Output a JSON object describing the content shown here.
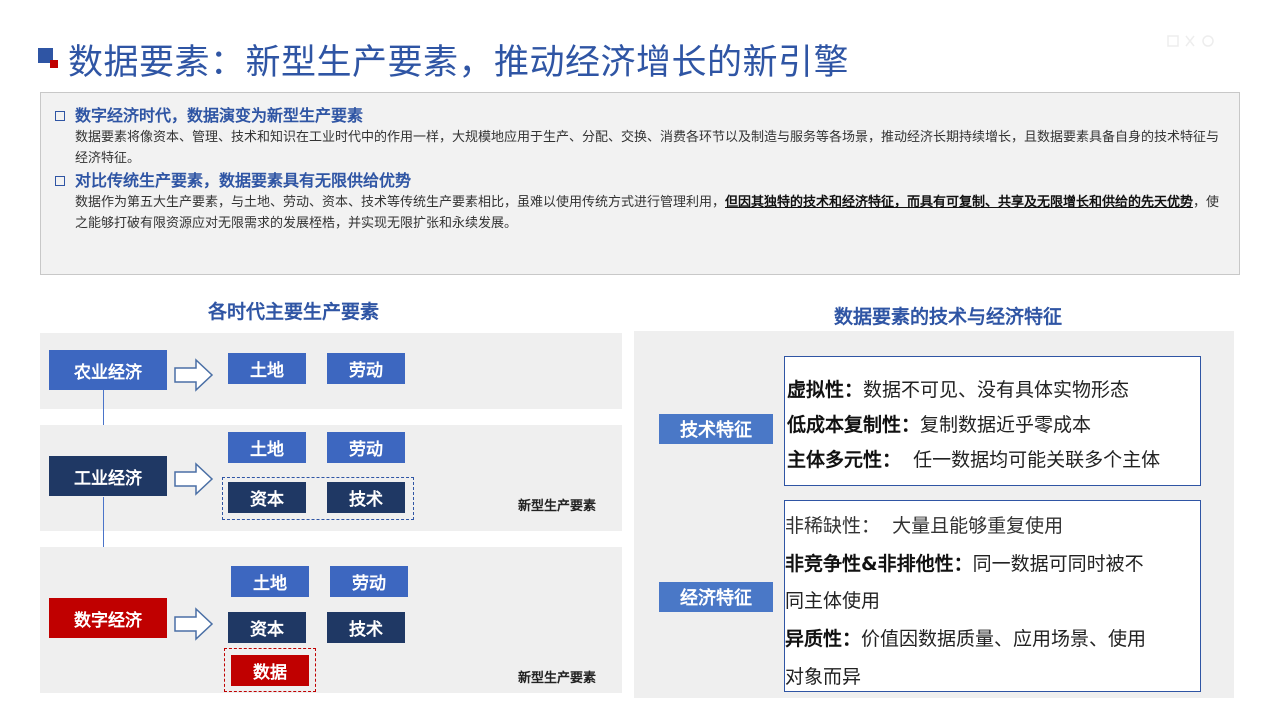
{
  "title": "数据要素：新型生产要素，推动经济增长的新引擎",
  "intro": {
    "p1_head": "数字经济时代，数据演变为新型生产要素",
    "p1_body": "数据要素将像资本、管理、技术和知识在工业时代中的作用一样，大规模地应用于生产、分配、交换、消费各环节以及制造与服务等各场景，推动经济长期持续增长，且数据要素具备自身的技术特征与经济特征。",
    "p2_head": "对比传统生产要素，数据要素具有无限供给优势",
    "p2_body_a": "数据作为第五大生产要素，与土地、劳动、资本、技术等传统生产要素相比，虽难以使用传统方式进行管理利用，",
    "p2_body_bold": "但因其独特的技术和经济特征，而具有可复制、共享及无限增长和供给的先天优势",
    "p2_body_b": "，使之能够打破有限资源应对无限需求的发展桎梏，并实现无限扩张和永续发展。"
  },
  "left": {
    "heading": "各时代主要生产要素",
    "agri": {
      "era": "农业经济",
      "f1": "土地",
      "f2": "劳动"
    },
    "indu": {
      "era": "工业经济",
      "f1": "土地",
      "f2": "劳动",
      "f3": "资本",
      "f4": "技术",
      "new_label": "新型生产要素"
    },
    "digi": {
      "era": "数字经济",
      "f1": "土地",
      "f2": "劳动",
      "f3": "资本",
      "f4": "技术",
      "f5": "数据",
      "new_label": "新型生产要素"
    }
  },
  "right": {
    "heading": "数据要素的技术与经济特征",
    "tech_tag": "技术特征",
    "tech": [
      {
        "k": "虚拟性：",
        "v": "数据不可见、没有具体实物形态"
      },
      {
        "k": "低成本复制性：",
        "v": "复制数据近乎零成本"
      },
      {
        "k": "主体多元性：",
        "v": "  任一数据均可能关联多个主体"
      }
    ],
    "econ_tag": "经济特征",
    "econ": {
      "l1": "非稀缺性：  大量且能够重复使用",
      "l2k": "非竞争性&非排他性：",
      "l2v": "同一数据可同时被不",
      "l3": "同主体使用",
      "l4k": "异质性：",
      "l4v": "价值因数据质量、应用场景、使用",
      "l5": "对象而异"
    }
  },
  "colors": {
    "brand_blue": "#2f55a4",
    "navy": "#1f3864",
    "red": "#c00000",
    "tag_blue": "#4a78c7"
  }
}
